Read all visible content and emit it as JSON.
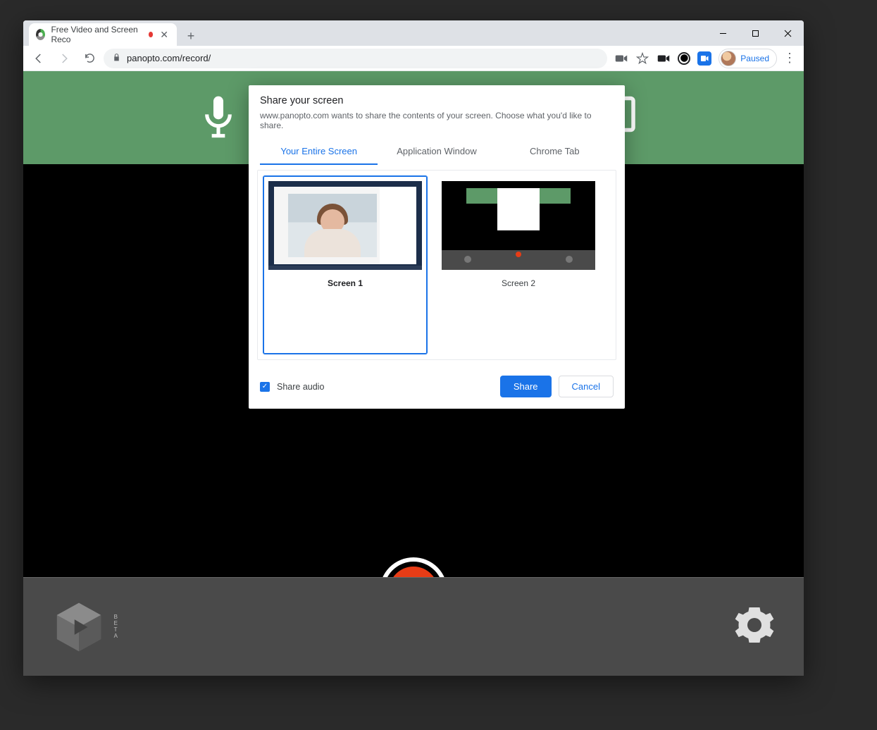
{
  "browser": {
    "tab_title": "Free Video and Screen Reco",
    "url_display": "panopto.com/record/",
    "profile_label": "Paused"
  },
  "dialog": {
    "title": "Share your screen",
    "subtitle": "www.panopto.com wants to share the contents of your screen. Choose what you'd like to share.",
    "tabs": {
      "entire": "Your Entire Screen",
      "app": "Application Window",
      "chrome": "Chrome Tab"
    },
    "screens": {
      "s1": "Screen 1",
      "s2": "Screen 2"
    },
    "share_audio_label": "Share audio",
    "share_btn": "Share",
    "cancel_btn": "Cancel"
  },
  "beta": {
    "b": "B",
    "e": "E",
    "t": "T",
    "a": "A"
  }
}
